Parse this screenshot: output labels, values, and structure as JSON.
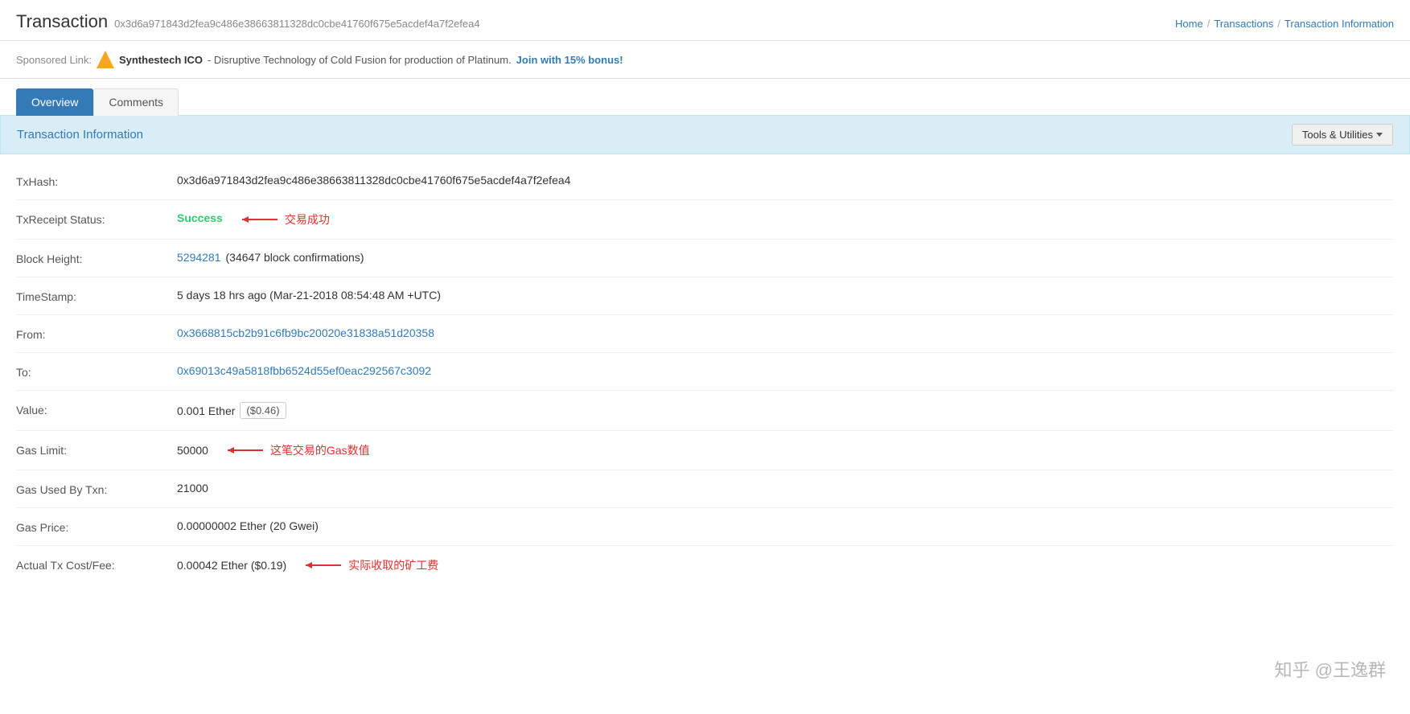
{
  "header": {
    "title": "Transaction",
    "hash": "0x3d6a971843d2fea9c486e38663811328dc0cbe41760f675e5acdef4a7f2efea4",
    "breadcrumb": {
      "home": "Home",
      "sep1": "/",
      "transactions": "Transactions",
      "sep2": "/",
      "current": "Transaction Information"
    }
  },
  "sponsored": {
    "label": "Sponsored Link:",
    "name": "Synthestech ICO",
    "description": "- Disruptive Technology of Cold Fusion for production of Platinum.",
    "link_text": "Join with 15% bonus!"
  },
  "tabs": [
    {
      "id": "overview",
      "label": "Overview",
      "active": true
    },
    {
      "id": "comments",
      "label": "Comments",
      "active": false
    }
  ],
  "section": {
    "title": "Transaction Information",
    "tools_label": "Tools & Utilities"
  },
  "fields": {
    "txhash": {
      "label": "TxHash:",
      "value": "0x3d6a971843d2fea9c486e38663811328dc0cbe41760f675e5acdef4a7f2efea4"
    },
    "txreceipt_status": {
      "label": "TxReceipt Status:",
      "value": "Success",
      "annotation": "交易成功"
    },
    "block_height": {
      "label": "Block Height:",
      "block_number": "5294281",
      "confirmations": "(34647 block confirmations)"
    },
    "timestamp": {
      "label": "TimeStamp:",
      "value": "5 days 18 hrs ago (Mar-21-2018 08:54:48 AM +UTC)"
    },
    "from": {
      "label": "From:",
      "value": "0x3668815cb2b91c6fb9bc20020e31838a51d20358"
    },
    "to": {
      "label": "To:",
      "value": "0x69013c49a5818fbb6524d55ef0eac292567c3092"
    },
    "value": {
      "label": "Value:",
      "amount": "0.001 Ether",
      "usd": "($0.46)"
    },
    "gas_limit": {
      "label": "Gas Limit:",
      "value": "50000",
      "annotation": "这笔交易的Gas数值"
    },
    "gas_used": {
      "label": "Gas Used By Txn:",
      "value": "21000"
    },
    "gas_price": {
      "label": "Gas Price:",
      "value": "0.00000002 Ether (20 Gwei)"
    },
    "actual_tx_cost": {
      "label": "Actual Tx Cost/Fee:",
      "value": "0.00042 Ether ($0.19)",
      "annotation": "实际收取的矿工费"
    }
  },
  "watermark": "知乎 @王逸群"
}
